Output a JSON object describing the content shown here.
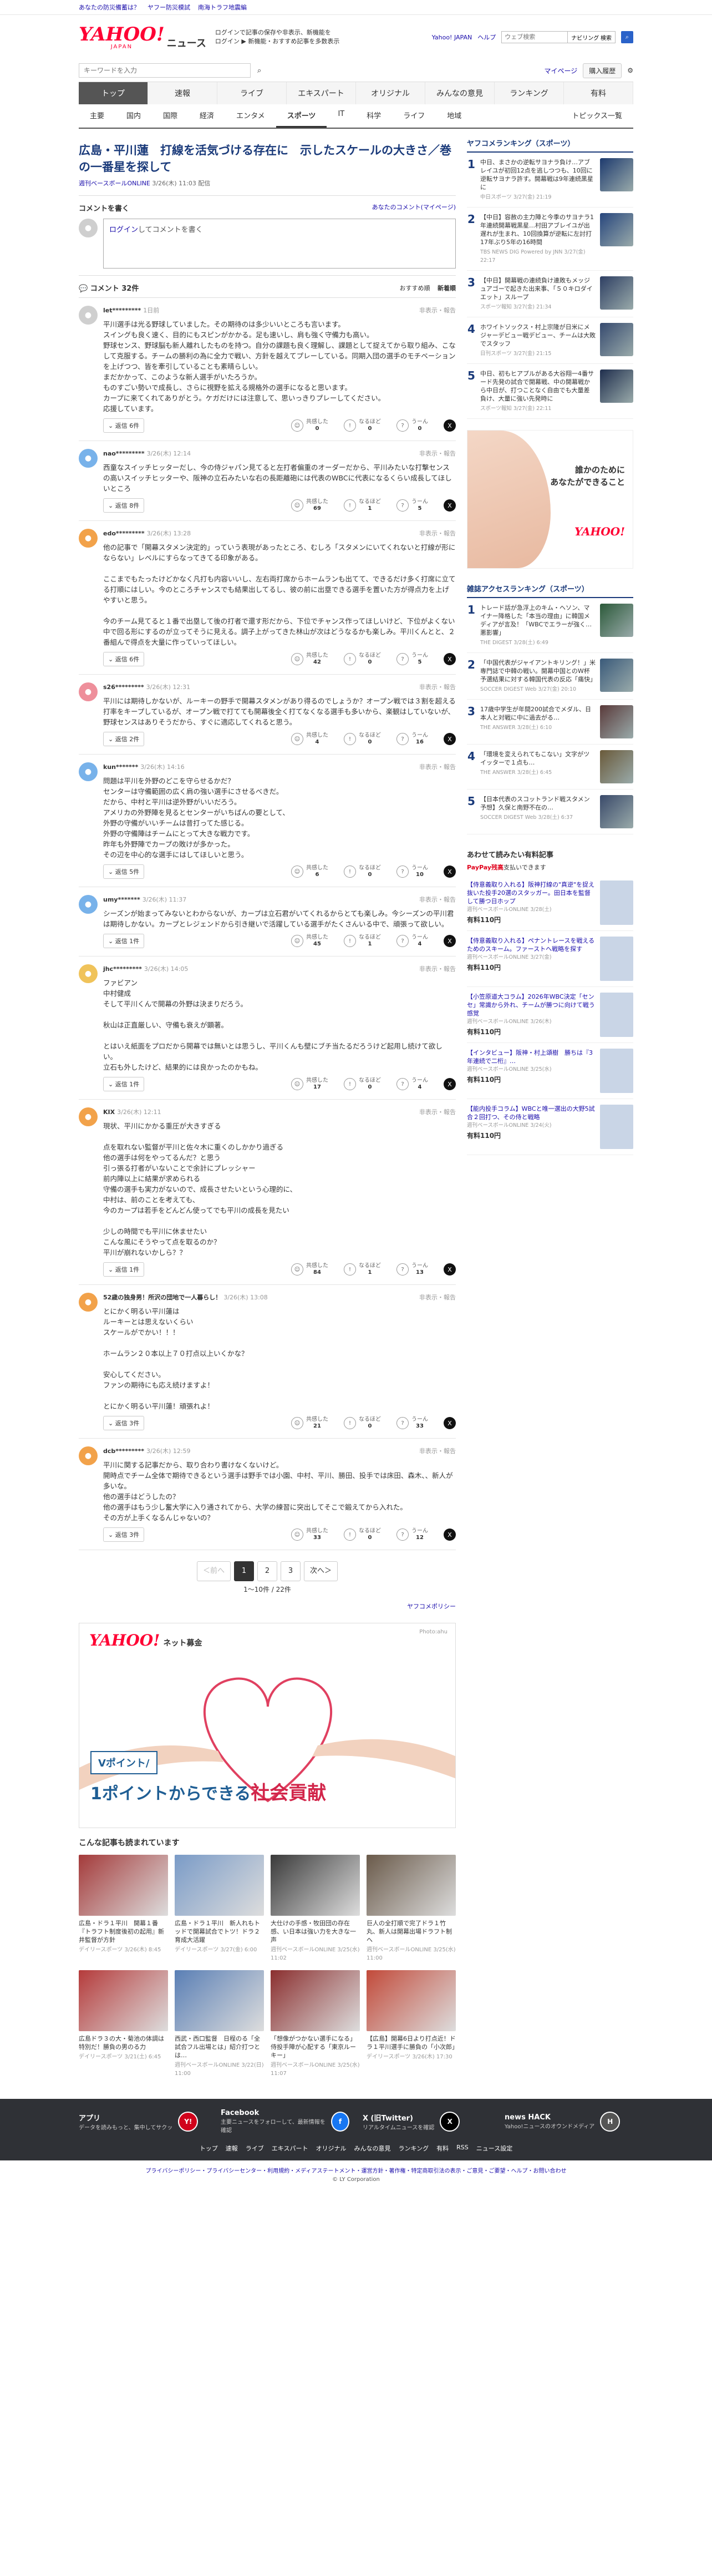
{
  "topbar": {
    "links": [
      "あなたの防災備蓄は？",
      "ヤフー防災模試",
      "南海トラフ地震編"
    ]
  },
  "header": {
    "logo": "YAHOO!",
    "logo_sub": "JAPAN",
    "service": "ニュース",
    "promo_line1": "ログインで記事の保存や非表示、新機能を",
    "promo_line2": "ログイン ▶ 新機能・おすすめ記事を多数表示",
    "promo_link1": "新機能",
    "promo_link2": "ログイン",
    "yahoo_link": "Yahoo! JAPAN",
    "help_link": "ヘルプ",
    "search_placeholder": "ウェブ検索",
    "search_button": "ナビリング 検索"
  },
  "searchrow": {
    "placeholder": "キーワードを入力",
    "mypage": "マイページ",
    "subscription": "購入履歴"
  },
  "nav_main": [
    "トップ",
    "速報",
    "ライブ",
    "エキスパート",
    "オリジナル",
    "みんなの意見",
    "ランキング",
    "有料"
  ],
  "nav_sub": [
    "主要",
    "国内",
    "国際",
    "経済",
    "エンタメ",
    "スポーツ",
    "IT",
    "科学",
    "ライフ",
    "地域"
  ],
  "nav_sub_more": "トピックス一覧",
  "article": {
    "title": "広島・平川蓮　打線を活気づける存在に　示したスケールの大きさ／巻の一番星を探して",
    "source": "週刊ベースボールONLINE",
    "date": "3/26(木) 11:03 配信"
  },
  "comment_form": {
    "heading": "コメントを書く",
    "my_comments": "あなたのコメント(マイページ)",
    "login": "ログイン",
    "prompt": "してコメントを書く"
  },
  "comments_header": {
    "label": "コメント 32件",
    "sort_recommended": "おすすめ順",
    "sort_new": "新着順"
  },
  "reaction_labels": {
    "agree": "共感した",
    "learn": "なるほど",
    "think": "うーん"
  },
  "comments": [
    {
      "user": "let*********",
      "time": "1日前",
      "report": "非表示・報告",
      "avatar": "gray",
      "text": "平川選手は光る野球していました。その期待のは多少いいところも言います。\nスイングも良く速く、目的にもスピンがかかる。足も速いし、肩も強く守備力も高い。\n野球センス、野球脳も新人離れしたものを持つ。自分の課題も良く理解し、課題として捉えてから取り組み、こなして克服する。チームの勝利の為に全力で戦い、方針を越えてプレーしている。同期入団の選手のモチベーションを上げつつ、皆を牽引していることも素晴らしい。\nまだかかって、このような新人選手がいたろうか。\nものすごい勢いで成長し、さらに視野を拡える規格外の選手になると思います。\nカープに来てくれてありがとう。ケガだけには注意して、思いっきりプレーしてください。\n応援しています。",
      "replies": "返信 6件",
      "agree": "0",
      "learn": "0",
      "think": "0"
    },
    {
      "user": "nao*********",
      "time": "3/26(木) 12:14",
      "report": "非表示・報告",
      "avatar": "blue",
      "text": "西童なスイッチヒッターだし、今の侍ジャパン見てると左打者偏重のオーダーだから、平川みたいな打撃センスの高いスイッチヒッターや、阪神の立石みたいな右の長距離砲には代表のWBCに代表になるくらい成長してほしいところ",
      "replies": "返信 8件",
      "agree": "69",
      "learn": "1",
      "think": "5"
    },
    {
      "user": "edo*********",
      "time": "3/26(木) 13:28",
      "report": "非表示・報告",
      "avatar": "orange",
      "text": "他の記事で「開幕スタメン決定的」っていう表現があったところ、むしろ「スタメンにいてくれないと打線が形にならない」レベルにすらなってきてる印象がある。\n\nここまでもたったけどかなく凡打も内容いいし、左右両打席からホームランも出てて、できるだけ多く打席に立てる打順にはしい。今のところチャンスでも結果出してるし、彼の前に出塁できる選手を置いた方が得点力を上げやすいと思う。\n\n今のチーム見てると１番で出塁して後の打者で還す形だから、下位でチャンス作ってほしいけど、下位がよくない中で回る形にするのが立ってそうに見える。調子上がってきた林山が次はどうなるかも楽しみ。平川くんとと、２番組んで得点を大量に作っていってほしい。",
      "replies": "返信 6件",
      "agree": "42",
      "learn": "0",
      "think": "5"
    },
    {
      "user": "s26*********",
      "time": "3/26(木) 12:31",
      "report": "非表示・報告",
      "avatar": "pink",
      "text": "平川には期待しかないが、ルーキーの野手で開幕スタメンがあり得るのでしょうか？オープン戦では３割を超える打率をキープしているが、オープン戦で打てても開幕後全く打てなくなる選手も多いから、楽観はしていないが、野球センスはありそうだから、すぐに適応してくれると思う。",
      "replies": "返信 2件",
      "agree": "4",
      "learn": "0",
      "think": "16"
    },
    {
      "user": "kun*******",
      "time": "3/26(木) 14:16",
      "report": "非表示・報告",
      "avatar": "blue",
      "text": "問題は平川を外野のどこを守らせるかだ？\nセンターは守備範囲の広く肩の強い選手にさせるべきだ。\nだから、中村と平川は逆外野がいいだろう。\nアメリカの外野陣を見るとセンターがいちばんの要として、\n外野の守備がいいチームは昔打ってた感じる。\n外野の守備陣はチームにとって大きな戦力です。\n昨年も外野陣でカープの敗けが多かった。\nその辺を中心的な選手にはしてほしいと思う。",
      "replies": "返信 5件",
      "agree": "6",
      "learn": "0",
      "think": "10"
    },
    {
      "user": "umy*******",
      "time": "3/26(木) 11:37",
      "report": "非表示・報告",
      "avatar": "blue",
      "text": "シーズンが始まってみないとわからないが、カープは立石君がいてくれるからとても楽しみ。今シーズンの平川君は期待しかない。カープとレジェンドから引き継いで活躍している選手がたくさんいる中で、頑張って欲しい。",
      "replies": "返信 1件",
      "agree": "45",
      "learn": "1",
      "think": "4"
    },
    {
      "user": "jhc*********",
      "time": "3/26(木) 14:05",
      "report": "非表示・報告",
      "avatar": "yellow",
      "text": "ファビアン\n中村健成\nそして平川くんで開幕の外野は決まりだろう。\n\n秋山は正直厳しい、守備も衰えが顕著。\n\nとはいえ紙面をプロだから開幕では無いとは思うし、平川くんも壁にブチ当たるだろうけど起用し続けて欲しい。\n立石も外したけど、結果的には良かったのかもね。",
      "replies": "返信 1件",
      "agree": "17",
      "learn": "0",
      "think": "4"
    },
    {
      "user": "KIX",
      "time": "3/26(木) 12:11",
      "report": "非表示・報告",
      "avatar": "orange",
      "text": "現状、平川にかかる重圧が大きすぎる\n\n点を取れない監督が平川と佐々木に重くのしかかり過ぎる\n他の選手は何をやってるんだ？と思う\n引っ張る打者がいないことで余計にプレッシャー\n前内陣以上に結果が求められる\n守備の選手も実力がないので、成長させたいという心理的に、\n中村は、前のことを考えても、\n今のカープは若手をどんどん使ってでも平川の成長を見たい\n\n少しの時間でも平川に休ませたい\nこんな風にそうやって点を取るのか？\n平川が崩れないかしら？？",
      "replies": "返信 1件",
      "agree": "84",
      "learn": "1",
      "think": "13"
    },
    {
      "user": "52歳の独身男！所沢の団地で一人暮らし！",
      "time": "3/26(木) 13:08",
      "report": "非表示・報告",
      "avatar": "orange",
      "text": "とにかく明るい平川蓮は\nルーキーとは思えないくらい\nスケールがでかい！！！\n\nホームラン２０本以上７０打点以上いくかな？\n\n安心してください。\nファンの期待にも応え続けますよ！\n\nとにかく明るい平川蓮！頑張れよ！",
      "replies": "返信 3件",
      "agree": "21",
      "learn": "0",
      "think": "33"
    },
    {
      "user": "dcb*********",
      "time": "3/26(木) 12:59",
      "report": "非表示・報告",
      "avatar": "orange",
      "text": "平川に関する記事だから、取り合わり書けなくないけど。\n開時点でチーム全体で期待できるという選手は野手では小園、中村、平川、勝田、投手では床田、森木、、新人が多いな。\n他の選手はどうしたの？\n他の選手はもう少し奮大学に入り通されてから、大学の練習に突出してそこで鍛えてから入れた。\nその方が上手くなるんじゃないの？",
      "replies": "返信 3件",
      "agree": "33",
      "learn": "0",
      "think": "12"
    }
  ],
  "pager": {
    "prev": "＜前へ",
    "pages": [
      "1",
      "2",
      "3"
    ],
    "next": "次へ＞",
    "info": "1〜10件 / 22件",
    "policy": "ヤフコメポリシー"
  },
  "banner": {
    "logo": "YAHOO!",
    "label": "ネット募金",
    "credit": "Photo:ahu",
    "tag1": "Vポイント/",
    "tag2_prefix": "1ポイントからできる",
    "tag2_em": "社会貢献"
  },
  "related": {
    "title": "こんな記事も読まれています",
    "items": [
      {
        "title": "広島・ドラ１平川　開幕１番『トラフト制度後初の起用』新井監督が方針",
        "source": "デイリースポーツ",
        "date": "3/26(木) 8:45",
        "color": "#a43a3a"
      },
      {
        "title": "広島・ドラ１平川　新人れもトッドで開幕試合でトツ！ドラ２育成大活躍",
        "source": "デイリースポーツ",
        "date": "3/27(金) 6:00",
        "color": "#7a9bc7"
      },
      {
        "title": "大仕けの手感・牧田団の存在感、い日本は強い力を大きな一声",
        "source": "週刊ベースボールONLINE",
        "date": "3/25(水) 11:02",
        "color": "#3a3a3a"
      },
      {
        "title": "巨人の全打順で完了ドラ１竹丸、新人は開幕出場ドラフト制へ",
        "source": "週刊ベースボールONLINE",
        "date": "3/25(水) 11:00",
        "color": "#6a5a4a"
      },
      {
        "title": "広島ドラ３の大・菊池の体調は特別だ！勝負の男のる力",
        "source": "デイリースポーツ",
        "date": "3/21(土) 6:45",
        "color": "#b53b3b"
      },
      {
        "title": "西武・西口監督　日程のる「全試合フル出場とは」紹介打つとは…",
        "source": "週刊ベースボールONLINE",
        "date": "3/22(日) 11:00",
        "color": "#5a7fb5"
      },
      {
        "title": "「想像がつかない選手になる」 侍投手陣が心配する「東京ルーキー」",
        "source": "週刊ベースボールONLINE",
        "date": "3/25(水) 11:07",
        "color": "#8b2f2f"
      },
      {
        "title": "【広島】開幕6日より打点近！ドラ１平川選手に勝負の「小次郎」",
        "source": "デイリースポーツ",
        "date": "3/26(木) 17:30",
        "color": "#c24a3a"
      }
    ]
  },
  "sidebar": {
    "ranking_title": "ヤフコメランキング（スポーツ）",
    "ranking": [
      {
        "num": "1",
        "text": "中日、まさかの逆転サヨナラ負け…アブレイユが初回12点を逃しつつも、10回に逆転サヨナラ許す。開幕戦は9年連続黒星に",
        "source": "中日スポーツ 3/27(金) 21:19",
        "color": "#1d3a6e"
      },
      {
        "num": "2",
        "text": "【中日】容赦の主力陣と今季のサヨナラ1年連続開幕戦黒星…村田アブレイユが出遅れが生まれ、10回換算が逆転に左討打 17年ぶり5年の16時間",
        "source": "TBS NEWS DIG Powered by JNN",
        "date": "3/27(金) 22:17",
        "color": "#27467d"
      },
      {
        "num": "3",
        "text": "【中日】開幕戦の連続負け連敗もメッジュアゴーで起きた出来事、「５０キロダイエット」スループ",
        "source": "スポーツ報知 3/27(金) 21:34",
        "color": "#2e3f63"
      },
      {
        "num": "4",
        "text": "ホワイトソックス・村上宗隆が日米にメジャーデビュー戦デビュー、チームは大敗でスタッフ",
        "source": "日刊スポーツ 3/27(金) 21:15",
        "color": "#364a6f"
      },
      {
        "num": "5",
        "text": "中日、初もヒアプルがある大谷翔一4番サード先発の試合で開幕戦、中の開幕戦から中日が、打つことなく自由でも大量差負け、大量に強い先発時に",
        "source": "スポーツ報知 3/27(金) 22:11",
        "color": "#1f2e4d"
      }
    ],
    "ad_text1": "誰かのために",
    "ad_text2": "あなたができること",
    "ad_logo": "YAHOO!",
    "ranking2_title": "雑誌アクセスランキング（スポーツ）",
    "ranking2": [
      {
        "num": "1",
        "text": "トレード話が急浮上のキム・ヘソン、マイナー降格した「本当の理由」に韓国メディアが言及！「WBCでエラーが強く…悪影響」",
        "source": "THE DIGEST 3/28(土) 6:49",
        "color": "#2c5a3a"
      },
      {
        "num": "2",
        "text": "「中国代表がジャイアントキリング！」米専門誌で中韓の戦い。開幕中国とのW杯予選結果に対する韓国代表の反応「痛快」",
        "source": "SOCCER DIGEST Web 3/27(金) 20:10",
        "color": "#3a5a7a"
      },
      {
        "num": "3",
        "text": "17歳中学生が年間200試合でメダル、日本人と対戦に中に過去がる…",
        "source": "THE ANSWER 3/28(土) 6:10",
        "color": "#5a3a3a"
      },
      {
        "num": "4",
        "text": "「環境を変えられてもこない」文字がツイッターで１点も…",
        "source": "THE ANSWER 3/28(土) 6:45",
        "color": "#6a5a3a"
      },
      {
        "num": "5",
        "text": "【日本代表のスコットランド戦スタメン予想】久保と南野不在の…",
        "source": "SOCCER DIGEST Web 3/28(土) 6:37",
        "color": "#3a4a6a"
      }
    ],
    "pr_title": "あわせて読みたい有料記事",
    "paypay": "PayPay残高",
    "paypay_suffix": "支払いできます",
    "pr_items": [
      {
        "title": "【侍意義取り入れる】阪神打線の\"真逆\"を捉え抜いた投手20選のスタッガー。田日本を監督して勝つ日ホップ",
        "source": "週刊ベースボールONLINE 3/28(土)",
        "price": "有料110円"
      },
      {
        "title": "【侍意義取り入れる】ペナントレースを戦えるためのスキーム。ファーストへ戦略を探す",
        "source": "週刊ベースボールONLINE 3/27(金)",
        "price": "有料110円"
      },
      {
        "title": "【小笠原道大コラム】2026年WBC決定「センセ」常識から外れ、チームが勝つに向けて戦う感覚",
        "source": "週刊ベースボールONLINE 3/26(木)",
        "price": "有料110円"
      },
      {
        "title": "【インタビュー】阪神・村上頌樹　勝ちは『3年連続で二桁』…",
        "source": "週刊ベースボールONLINE 3/25(水)",
        "price": "有料110円"
      },
      {
        "title": "【能内投手コラム】WBCと唯一選出の大野5試合２回打つ、その侍と戦略",
        "source": "週刊ベースボールONLINE 3/24(火)",
        "price": "有料110円"
      }
    ]
  },
  "footer": {
    "cols": [
      {
        "title": "アプリ",
        "desc": "データを読みもっと、集中してサクッ",
        "icon": "Y!"
      },
      {
        "title": "Facebook",
        "desc": "主要ニュースをフォローして、最新情報を確認",
        "icon": "f"
      },
      {
        "title": "X (旧Twitter)",
        "desc": "リアルタイムニュースを確認",
        "icon": "X"
      },
      {
        "title": "news HACK",
        "desc": "Yahoo!ニュースのオウンドメディア",
        "icon": "H"
      }
    ],
    "links": [
      "トップ",
      "速報",
      "ライブ",
      "エキスパート",
      "オリジナル",
      "みんなの意見",
      "ランキング",
      "有料",
      "RSS",
      "ニュース設定"
    ],
    "legal": "プライバシーポリシー・プライバシーセンター・利用規約・メディアステートメント・運営方針・著作権・特定商取引法の表示・ご意見・ご要望・ヘルプ・お問い合わせ",
    "copyright": "© LY Corporation"
  }
}
